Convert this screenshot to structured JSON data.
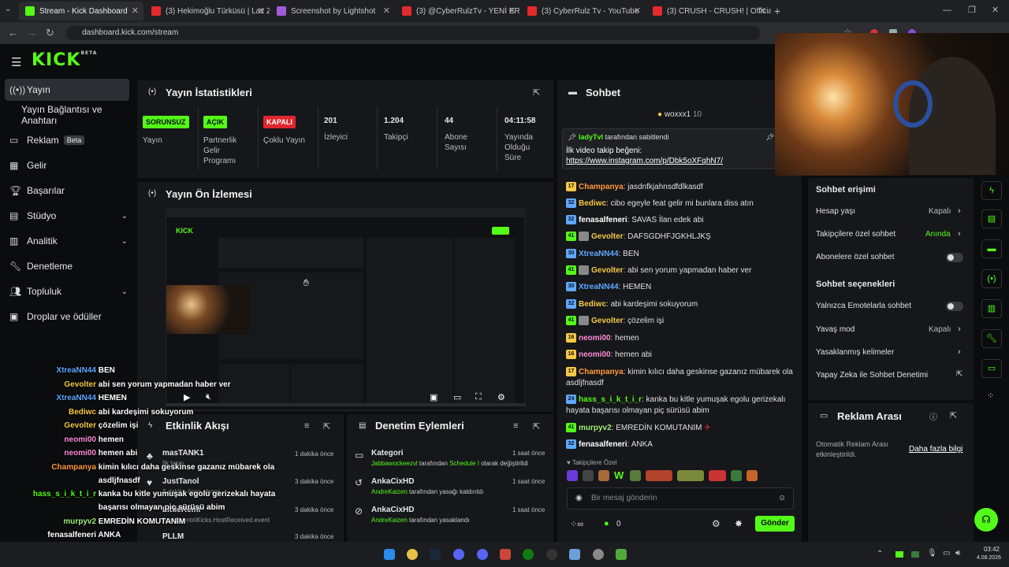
{
  "browser": {
    "tabs": [
      {
        "label": "Stream - Kick Dashboard",
        "active": true
      },
      {
        "label": "(3) Hekimoğlu Türküsü | Laz Ziy"
      },
      {
        "label": "Screenshot by Lightshot"
      },
      {
        "label": "(3) @CyberRulzTv - YENİ ERKEK"
      },
      {
        "label": "(3) CyberRulz Tv - YouTube"
      },
      {
        "label": "(3) CRUSH - CRUSH! | Official M"
      }
    ],
    "url": "dashboard.kick.com/stream"
  },
  "brand": {
    "logo": "KICK",
    "beta": "BETA"
  },
  "sidebar": {
    "items": [
      {
        "label": "Yayın",
        "icon": "broadcast-icon"
      },
      {
        "label": "Yayın Bağlantısı ve Anahtarı"
      },
      {
        "label": "Reklam",
        "badge": "Beta",
        "icon": "monitor-icon"
      },
      {
        "label": "Gelir",
        "icon": "chart-icon"
      },
      {
        "label": "Başarılar",
        "icon": "trophy-icon"
      },
      {
        "label": "Stüdyo",
        "icon": "studio-icon",
        "chevron": "⌄"
      },
      {
        "label": "Analitik",
        "icon": "analytics-icon",
        "chevron": "⌄"
      },
      {
        "label": "Denetleme",
        "icon": "wrench-icon"
      },
      {
        "label": "Topluluk",
        "icon": "people-icon",
        "chevron": "⌄"
      },
      {
        "label": "Droplar ve ödüller",
        "icon": "gift-icon"
      }
    ]
  },
  "stats": {
    "title": "Yayın İstatistikleri",
    "cells": [
      {
        "badge": "SORUNSUZ",
        "label": "Yayın"
      },
      {
        "badge": "AÇIK",
        "label": "Partnerlik Gelir Programı"
      },
      {
        "badge": "KAPALI",
        "label": "Çoklu Yayın"
      },
      {
        "value": "201",
        "label": "İzleyici"
      },
      {
        "value": "1.204",
        "label": "Takipçi"
      },
      {
        "value": "44",
        "label": "Abone Sayısı"
      },
      {
        "value": "04:11:58",
        "label": "Yayında Olduğu Süre"
      }
    ]
  },
  "preview": {
    "title": "Yayın Ön İzlemesi"
  },
  "activity": {
    "title": "Etkinlik Akışı",
    "items": [
      {
        "name": "masTANK1",
        "sub": "İlk takip",
        "time": "1 dakika önce"
      },
      {
        "name": "JustTanol",
        "sub": "3 dakika önce abone",
        "time": "3 dakika önce"
      },
      {
        "name": "LittleRemi",
        "sub": "App\\Events\\Kicks.HostReceived.event",
        "time": "3 dakika önce"
      },
      {
        "name": "PLLM",
        "sub": "",
        "time": "3 dakika önce"
      }
    ]
  },
  "moderation": {
    "title": "Denetim Eylemleri",
    "items": [
      {
        "title": "Kategori",
        "actor": "Jabbawockeezvl",
        "text": " tarafından ",
        "target": "Schedule I",
        "tail": " olarak değiştirildi",
        "time": "1 saat önce"
      },
      {
        "title": "AnkaCixHD",
        "actor": "AndreKaizen",
        "text": " tarafından yasağı kaldırıldı",
        "target": "",
        "tail": "",
        "time": "1 saat önce"
      },
      {
        "title": "AnkaCixHD",
        "actor": "AndreKaizen",
        "text": " tarafından yasaklandı",
        "target": "",
        "tail": "",
        "time": "1 saat önce"
      }
    ]
  },
  "chat": {
    "title": "Sohbet",
    "top_gifter": {
      "name": "woxxx1",
      "count": "10"
    },
    "pinned": {
      "by": "ladyTvl",
      "by_suffix": " tarafından sabitlendi",
      "line1": "İlk video takip beğeni:",
      "link": "https://www.instagram.com/p/Dbk5oXFqhN7/"
    },
    "messages": [
      {
        "lvl": "17",
        "lvlcolor": "#f6c945",
        "user": "Champanya",
        "color": "#ff9a3c",
        "text": "jasdnfkjahnsdfdlkasdf"
      },
      {
        "lvl": "32",
        "lvlcolor": "#5fa8ff",
        "user": "Bediwc",
        "color": "#f6c945",
        "text": "cibo egeyle feat gelir mi bunlara diss atın"
      },
      {
        "lvl": "32",
        "lvlcolor": "#5fa8ff",
        "user": "fenasalfeneri",
        "color": "#ffffff",
        "text": "SAVAS İlan edek abi"
      },
      {
        "lvl": "41",
        "lvlcolor": "#53fc18",
        "user": "Gevolter",
        "color": "#f6c945",
        "text": "DAFSGDHFJGKHLJKŞ"
      },
      {
        "lvl": "30",
        "lvlcolor": "#5fa8ff",
        "user": "XtreaNN44",
        "color": "#5fa8ff",
        "text": "BEN"
      },
      {
        "lvl": "41",
        "lvlcolor": "#53fc18",
        "user": "Gevolter",
        "color": "#f6c945",
        "text": "abi sen yorum yapmadan haber ver"
      },
      {
        "lvl": "30",
        "lvlcolor": "#5fa8ff",
        "user": "XtreaNN44",
        "color": "#5fa8ff",
        "text": "HEMEN"
      },
      {
        "lvl": "32",
        "lvlcolor": "#5fa8ff",
        "user": "Bediwc",
        "color": "#f6c945",
        "text": "abi kardeşimi sokuyorum"
      },
      {
        "lvl": "41",
        "lvlcolor": "#53fc18",
        "user": "Gevolter",
        "color": "#f6c945",
        "text": "çözelim işi"
      },
      {
        "lvl": "16",
        "lvlcolor": "#f6c945",
        "user": "neomi00",
        "color": "#ff8ad8",
        "text": "hemen"
      },
      {
        "lvl": "16",
        "lvlcolor": "#f6c945",
        "user": "neomi00",
        "color": "#ff8ad8",
        "text": "hemen abi"
      },
      {
        "lvl": "17",
        "lvlcolor": "#f6c945",
        "user": "Champanya",
        "color": "#ff9a3c",
        "text": "kimin kılıcı daha geskinse gazanız mübarek ola asdljfnasdf"
      },
      {
        "lvl": "24",
        "lvlcolor": "#5fa8ff",
        "user": "hass_s_i_k_t_i_r",
        "color": "#53fc18",
        "text": "kanka bu kitle yumuşak egolu gerizekalı hayata başarısı olmayan piç sürüsü abim"
      },
      {
        "lvl": "41",
        "lvlcolor": "#53fc18",
        "user": "murpyv2",
        "color": "#9ef07a",
        "text": "EMREDİN KOMUTANIM"
      },
      {
        "lvl": "32",
        "lvlcolor": "#5fa8ff",
        "user": "fenasalfeneri",
        "color": "#ffffff",
        "text": "ANKA"
      }
    ],
    "followers_only": "Takipçilere Özel",
    "input_placeholder": "Bir mesaj gönderin",
    "points": "0",
    "send_label": "Gönder",
    "colors": {
      "accent": "#53fc18"
    }
  },
  "chat_settings": {
    "access_title": "Sohbet erişimi",
    "account_age": {
      "label": "Hesap yaşı",
      "value": "Kapalı"
    },
    "followers_chat": {
      "label": "Takipçilere özel sohbet",
      "value": "Anında"
    },
    "subs_chat": {
      "label": "Abonelere özel sohbet"
    },
    "options_title": "Sohbet seçenekleri",
    "emotes_only": {
      "label": "Yalnızca Emotelarla sohbet"
    },
    "slow_mode": {
      "label": "Yavaş mod",
      "value": "Kapalı"
    },
    "banned_words": {
      "label": "Yasaklanmış kelimeler"
    },
    "ai_moderation": {
      "label": "Yapay Zeka ile Sohbet Denetimi"
    }
  },
  "ad_break": {
    "title": "Reklam Arası",
    "desc": "Otomatik Reklam Arası etkinleştirildi.",
    "link": "Daha fazla bilgi"
  },
  "overlay_chat": [
    {
      "user": "XtreaNN44",
      "color": "#5fa8ff",
      "text": "BEN"
    },
    {
      "user": "Gevolter",
      "color": "#f6c945",
      "text": "abi sen yorum yapmadan haber ver"
    },
    {
      "user": "XtreaNN44",
      "color": "#5fa8ff",
      "text": "HEMEN"
    },
    {
      "user": "Bediwc",
      "color": "#f6c945",
      "text": "abi kardeşimi sokuyorum"
    },
    {
      "user": "Gevolter",
      "color": "#f6c945",
      "text": "çözelim işi"
    },
    {
      "user": "neomi00",
      "color": "#ff8ad8",
      "text": "hemen"
    },
    {
      "user": "neomi00",
      "color": "#ff8ad8",
      "text": "hemen abi"
    },
    {
      "user": "Champanya",
      "color": "#ff9a3c",
      "text": "kimin kılıcı daha geskinse gazanız mübarek ola"
    },
    {
      "user": "",
      "color": "#ffffff",
      "text": "asdljfnasdf"
    },
    {
      "user": "hass_s_i_k_t_i_r",
      "color": "#53fc18",
      "text": "kanka bu kitle yumuşak egolu gerizekalı hayata"
    },
    {
      "user": "",
      "color": "#ffffff",
      "text": "başarısı olmayan piç sürüsü abim"
    },
    {
      "user": "murpyv2",
      "color": "#9ef07a",
      "text": "EMREDİN KOMUTANIM"
    },
    {
      "user": "fenasalfeneri",
      "color": "#ffffff",
      "text": "ANKA"
    }
  ],
  "taskbar": {
    "time": "03:42",
    "date": "4.08.2026"
  }
}
